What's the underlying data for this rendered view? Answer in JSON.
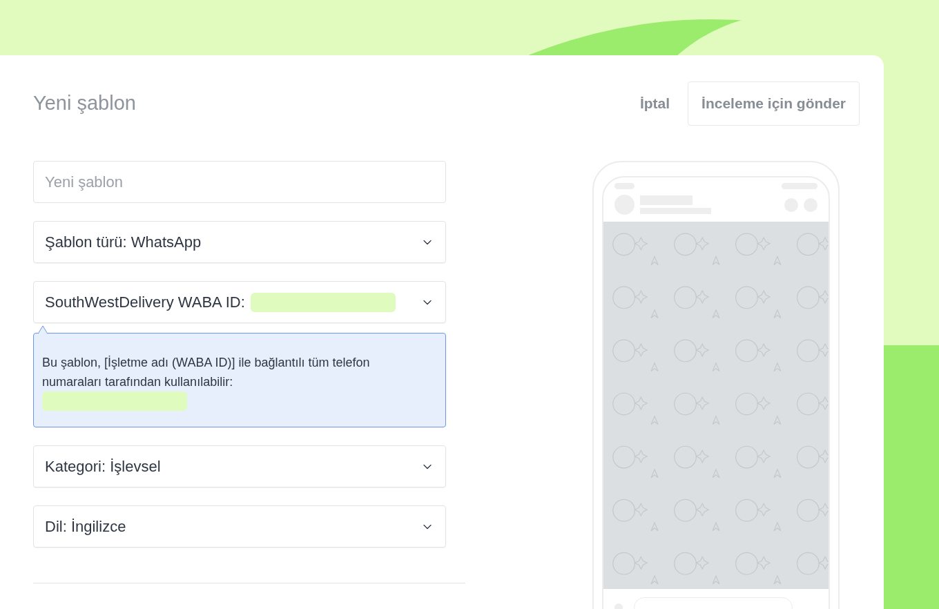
{
  "header": {
    "title": "Yeni şablon",
    "cancel": "İptal",
    "submit": "İnceleme için gönder"
  },
  "fields": [
    {
      "kind": "input",
      "placeholder": "Yeni şablon"
    },
    {
      "kind": "select",
      "label": "Şablon türü: WhatsApp"
    },
    {
      "kind": "select",
      "label": "SouthWestDelivery WABA ID:",
      "redacted": true,
      "note": {
        "text": "Bu şablon, [İşletme adı (WABA ID)] ile bağlantılı tüm telefon numaraları tarafından kullanılabilir:",
        "redacted": true
      }
    },
    {
      "kind": "select",
      "label": "Kategori: İşlevsel"
    },
    {
      "kind": "select",
      "label": "Dil: İngilizce"
    }
  ]
}
